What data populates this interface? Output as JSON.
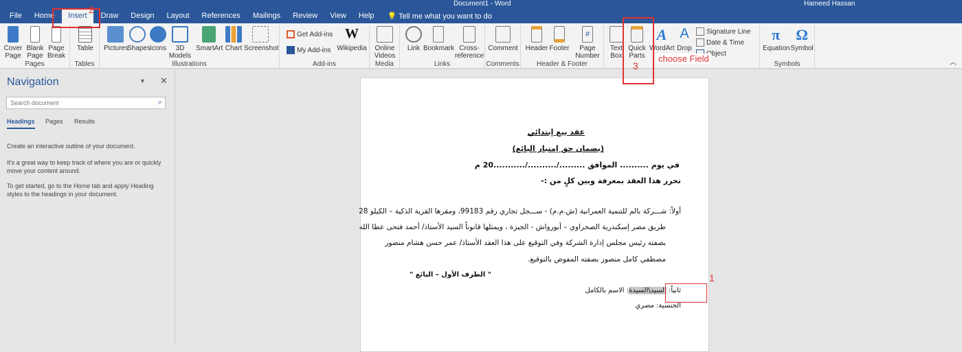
{
  "titlebar": {
    "title": "Document1 - Word",
    "user": "Hameed Hassan"
  },
  "tabs": [
    "File",
    "Home",
    "Insert",
    "Draw",
    "Design",
    "Layout",
    "References",
    "Mailings",
    "Review",
    "View",
    "Help"
  ],
  "tell_me": "Tell me what you want to do",
  "ribbon": {
    "pages": {
      "label": "Pages",
      "cover": "Cover\nPage",
      "blank": "Blank\nPage",
      "break": "Page\nBreak"
    },
    "tables": {
      "label": "Tables",
      "table": "Table"
    },
    "illustrations": {
      "label": "Illustrations",
      "pictures": "Pictures",
      "shapes": "Shapes",
      "icons": "Icons",
      "models": "3D\nModels",
      "smartart": "SmartArt",
      "chart": "Chart",
      "screenshot": "Screenshot"
    },
    "addins": {
      "label": "Add-ins",
      "get": "Get Add-ins",
      "my": "My Add-ins",
      "wiki": "Wikipedia"
    },
    "media": {
      "label": "Media",
      "video": "Online\nVideos"
    },
    "links": {
      "label": "Links",
      "link": "Link",
      "bookmark": "Bookmark",
      "xref": "Cross-\nreference"
    },
    "comments": {
      "label": "Comments",
      "comment": "Comment"
    },
    "hf": {
      "label": "Header & Footer",
      "header": "Header",
      "footer": "Footer",
      "pagenum": "Page\nNumber"
    },
    "text": {
      "textbox": "Text\nBox",
      "quickparts": "Quick\nParts",
      "wordart": "WordArt",
      "drop": "Drop",
      "sig": "Signature Line",
      "date": "Date & Time",
      "object": "Object"
    },
    "symbols": {
      "label": "Symbols",
      "equation": "Equation",
      "symbol": "Symbol"
    }
  },
  "nav": {
    "title": "Navigation",
    "search_placeholder": "Search document",
    "tabs": [
      "Headings",
      "Pages",
      "Results"
    ],
    "p1": "Create an interactive outline of your document.",
    "p2": "It's a great way to keep track of where you are or quickly move your content around.",
    "p3": "To get started, go to the Home tab and apply Heading styles to the headings in your document."
  },
  "doc": {
    "title": "عقد بيع إبتدائي",
    "subtitle": "(بضمان حق إمتياز البائع)",
    "date_line": "في يوم .......... الموافق ........./........../...........20  م",
    "intro": "تحرر هذا العقد بمعرفة وبين كلٍ من :-",
    "p1": "أولاً: شـــركة بالم للتنمية العمرانية (ش.م.م) - ســـجل تجاري رقم 99183، ومقرها القرية الذكية – الكيلو 28",
    "p2": "طريق مصر إسكندرية الصحراوي – أبورواش - الجيزة ، ويمثلها قانوناً السيد الأستاذ/ أحمد فتحى عطا الله",
    "p3": "بصفته رئيس مجلس إدارة الشركة وفي التوقيع على هذا العقد الأستاذ/ عمر حسن هشام منصور",
    "p4": "مصطفي كامل منصور بصفته المفوض بالتوقيع.",
    "party": "\" الطرف الأول –  البائع \"",
    "second_prefix": "ثانياً: ",
    "field": "السيد\\السيدة",
    "second_rest": ": الاسم بالكامل",
    "nationality": "الجنسية: مصري"
  },
  "annotations": {
    "n1": "1",
    "n2": "2",
    "n3": "3",
    "hint": "choose Field"
  },
  "colors": {
    "brand": "#2b579a",
    "annotation": "#e03030"
  }
}
